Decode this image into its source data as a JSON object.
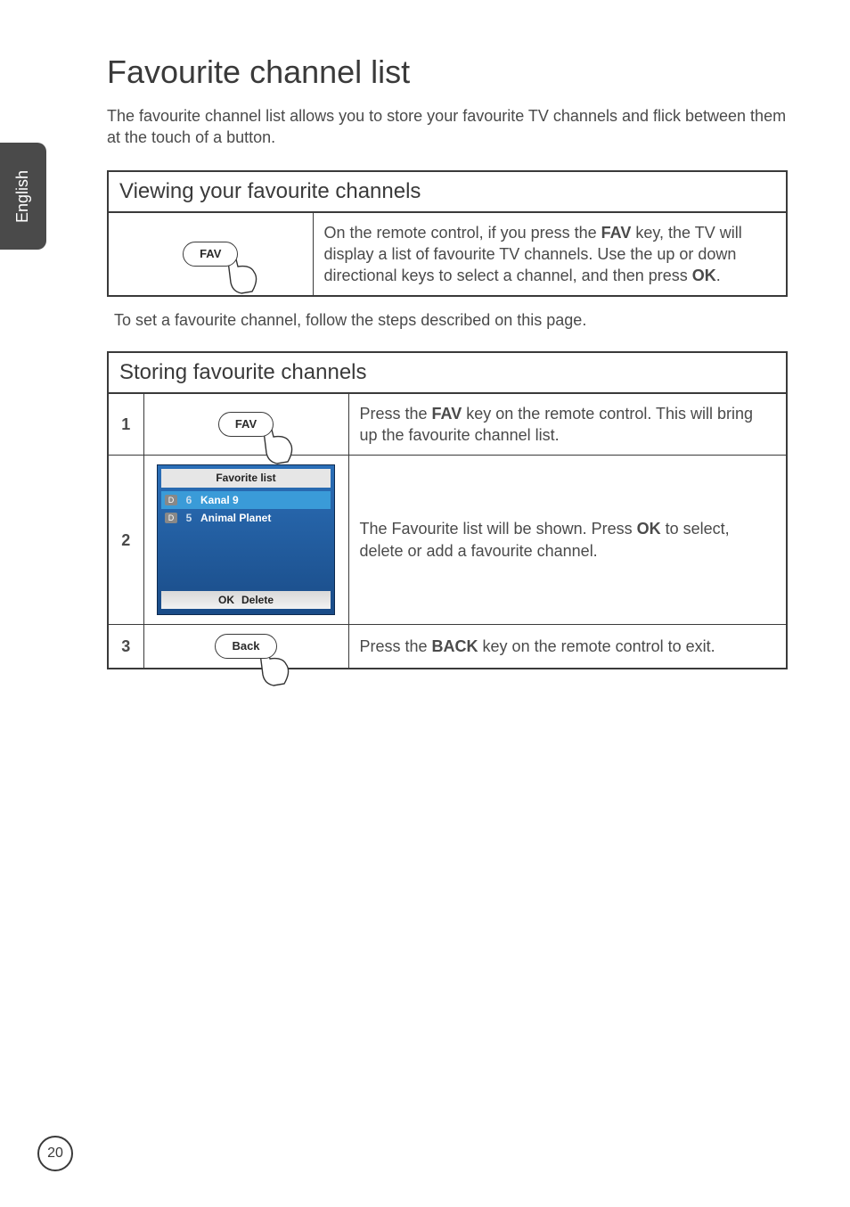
{
  "tab_label": "English",
  "title": "Favourite channel list",
  "intro": "The favourite channel list allows you to store your favourite TV channels and flick between them at the touch of a button.",
  "viewing": {
    "header": "Viewing your favourite channels",
    "key_label": "FAV",
    "desc_pre": "On the remote control, if you press the ",
    "desc_bold1": "FAV",
    "desc_mid": " key, the TV will display a list of favourite TV channels. Use the up or down directional keys to select a channel, and then press ",
    "desc_bold2": "OK",
    "desc_post": "."
  },
  "middle_note": "To set a favourite channel, follow the steps described on this page.",
  "storing": {
    "header": "Storing favourite channels",
    "steps": [
      {
        "num": "1",
        "key_label": "FAV",
        "desc_pre": "Press the ",
        "desc_bold": "FAV",
        "desc_post": " key on the remote control. This will bring up the favourite channel list."
      },
      {
        "num": "2",
        "favlist": {
          "title": "Favorite list",
          "rows": [
            {
              "badge": "D",
              "num": "6",
              "name": "Kanal 9",
              "selected": true
            },
            {
              "badge": "D",
              "num": "5",
              "name": "Animal Planet",
              "selected": false
            }
          ],
          "footer_ok": "OK",
          "footer_delete": "Delete"
        },
        "desc_pre": "The Favourite list will be shown. Press ",
        "desc_bold": "OK",
        "desc_post": " to select, delete or add a favourite channel."
      },
      {
        "num": "3",
        "key_label": "Back",
        "desc_pre": "Press the ",
        "desc_bold": "BACK",
        "desc_post": " key on the remote control to exit."
      }
    ]
  },
  "page_number": "20"
}
